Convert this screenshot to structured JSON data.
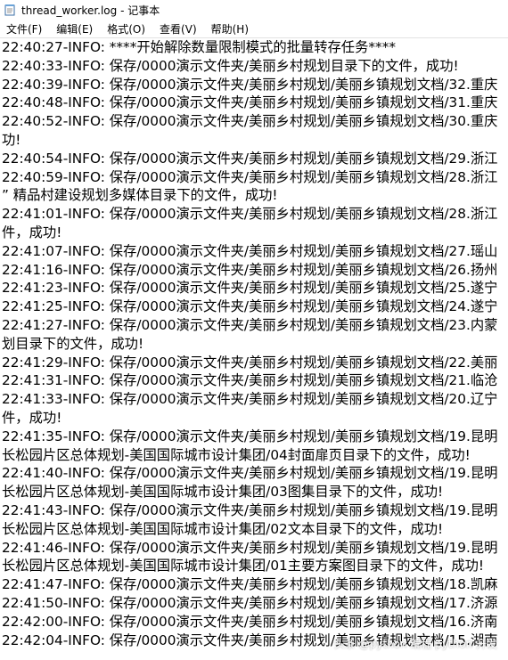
{
  "window": {
    "title": "thread_worker.log - 记事本"
  },
  "menubar": {
    "items": [
      {
        "name": "menu-file",
        "label": "文件(F)"
      },
      {
        "name": "menu-edit",
        "label": "编辑(E)"
      },
      {
        "name": "menu-format",
        "label": "格式(O)"
      },
      {
        "name": "menu-view",
        "label": "查看(V)"
      },
      {
        "name": "menu-help",
        "label": "帮助(H)"
      }
    ]
  },
  "editor": {
    "lines": [
      "22:40:27-INFO: ****开始解除数量限制模式的批量转存任务****",
      "22:40:33-INFO: 保存/0000演示文件夹/美丽乡村规划目录下的文件，成功!",
      "22:40:39-INFO: 保存/0000演示文件夹/美丽乡村规划/美丽乡镇规划文档/32.重庆",
      "22:40:48-INFO: 保存/0000演示文件夹/美丽乡村规划/美丽乡镇规划文档/31.重庆",
      "22:40:52-INFO: 保存/0000演示文件夹/美丽乡村规划/美丽乡镇规划文档/30.重庆",
      "功!",
      "22:40:54-INFO: 保存/0000演示文件夹/美丽乡村规划/美丽乡镇规划文档/29.浙江",
      "22:40:59-INFO: 保存/0000演示文件夹/美丽乡村规划/美丽乡镇规划文档/28.浙江",
      "” 精品村建设规划多媒体目录下的文件，成功!",
      "22:41:01-INFO: 保存/0000演示文件夹/美丽乡村规划/美丽乡镇规划文档/28.浙江",
      "件，成功!",
      "22:41:07-INFO: 保存/0000演示文件夹/美丽乡村规划/美丽乡镇规划文档/27.瑶山",
      "22:41:16-INFO: 保存/0000演示文件夹/美丽乡村规划/美丽乡镇规划文档/26.扬州",
      "22:41:23-INFO: 保存/0000演示文件夹/美丽乡村规划/美丽乡镇规划文档/25.遂宁",
      "22:41:25-INFO: 保存/0000演示文件夹/美丽乡村规划/美丽乡镇规划文档/24.遂宁",
      "22:41:27-INFO: 保存/0000演示文件夹/美丽乡村规划/美丽乡镇规划文档/23.内蒙",
      "划目录下的文件，成功!",
      "22:41:29-INFO: 保存/0000演示文件夹/美丽乡村规划/美丽乡镇规划文档/22.美丽",
      "22:41:31-INFO: 保存/0000演示文件夹/美丽乡村规划/美丽乡镇规划文档/21.临沧",
      "22:41:33-INFO: 保存/0000演示文件夹/美丽乡村规划/美丽乡镇规划文档/20.辽宁",
      "件，成功!",
      "22:41:35-INFO: 保存/0000演示文件夹/美丽乡村规划/美丽乡镇规划文档/19.昆明",
      "长松园片区总体规划-美国国际城市设计集团/04封面扉页目录下的文件，成功!",
      "22:41:40-INFO: 保存/0000演示文件夹/美丽乡村规划/美丽乡镇规划文档/19.昆明",
      "长松园片区总体规划-美国国际城市设计集团/03图集目录下的文件，成功!",
      "22:41:43-INFO: 保存/0000演示文件夹/美丽乡村规划/美丽乡镇规划文档/19.昆明",
      "长松园片区总体规划-美国国际城市设计集团/02文本目录下的文件，成功!",
      "22:41:46-INFO: 保存/0000演示文件夹/美丽乡村规划/美丽乡镇规划文档/19.昆明",
      "长松园片区总体规划-美国国际城市设计集团/01主要方案图目录下的文件，成功!",
      "22:41:47-INFO: 保存/0000演示文件夹/美丽乡村规划/美丽乡镇规划文档/18.凯麻",
      "22:41:50-INFO: 保存/0000演示文件夹/美丽乡村规划/美丽乡镇规划文档/17.济源",
      "22:42:00-INFO: 保存/0000演示文件夹/美丽乡村规划/美丽乡镇规划文档/16.济南",
      "22:42:04-INFO: 保存/0000演示文件夹/美丽乡村规划/美丽乡镇规划文档/15.湖南"
    ]
  },
  "watermark": {
    "text": "头条 @python 编程 python 开发"
  },
  "icons": {
    "app": "notepad-icon"
  }
}
